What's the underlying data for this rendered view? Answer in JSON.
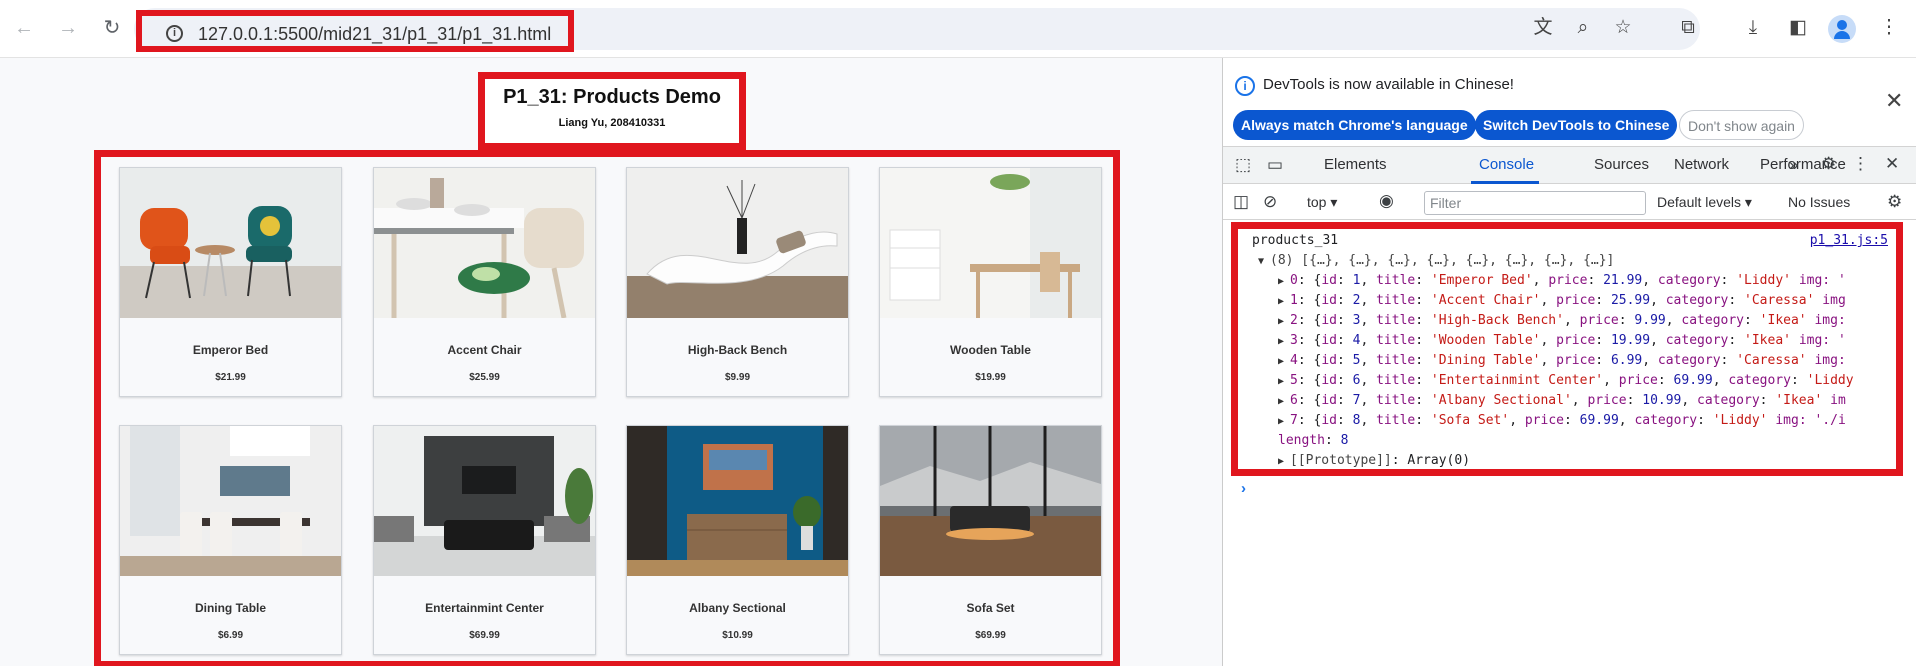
{
  "browser": {
    "url": "127.0.0.1:5500/mid21_31/p1_31/p1_31.html"
  },
  "page": {
    "title": "P1_31: Products Demo",
    "subtitle": "Liang Yu, 208410331",
    "products": [
      {
        "name": "Emperor Bed",
        "price": "$21.99"
      },
      {
        "name": "Accent Chair",
        "price": "$25.99"
      },
      {
        "name": "High-Back Bench",
        "price": "$9.99"
      },
      {
        "name": "Wooden Table",
        "price": "$19.99"
      },
      {
        "name": "Dining Table",
        "price": "$6.99"
      },
      {
        "name": "Entertainmint Center",
        "price": "$69.99"
      },
      {
        "name": "Albany Sectional",
        "price": "$10.99"
      },
      {
        "name": "Sofa Set",
        "price": "$69.99"
      }
    ]
  },
  "devtools": {
    "banner": "DevTools is now available in Chinese!",
    "btn_match": "Always match Chrome's language",
    "btn_switch": "Switch DevTools to Chinese",
    "btn_dont": "Don't show again",
    "tabs": [
      "Elements",
      "Console",
      "Sources",
      "Network",
      "Performance"
    ],
    "context": "top",
    "filter_placeholder": "Filter",
    "levels": "Default levels",
    "issues": "No Issues",
    "console": {
      "label": "products_31",
      "source": "p1_31.js:5",
      "summary": "(8) [{…}, {…}, {…}, {…}, {…}, {…}, {…}, {…}]",
      "rows": [
        {
          "index": "0",
          "id": "1",
          "title": "'Emperor Bed'",
          "price": "21.99",
          "category": "'Liddy'",
          "tail": "img: '"
        },
        {
          "index": "1",
          "id": "2",
          "title": "'Accent Chair'",
          "price": "25.99",
          "category": "'Caressa'",
          "tail": "img"
        },
        {
          "index": "2",
          "id": "3",
          "title": "'High-Back Bench'",
          "price": "9.99",
          "category": "'Ikea'",
          "tail": "img:"
        },
        {
          "index": "3",
          "id": "4",
          "title": "'Wooden Table'",
          "price": "19.99",
          "category": "'Ikea'",
          "tail": "img: '"
        },
        {
          "index": "4",
          "id": "5",
          "title": "'Dining Table'",
          "price": "6.99",
          "category": "'Caressa'",
          "tail": "img:"
        },
        {
          "index": "5",
          "id": "6",
          "title": "'Entertainmint Center'",
          "price": "69.99",
          "category": "'Liddy",
          "tail": ""
        },
        {
          "index": "6",
          "id": "7",
          "title": "'Albany Sectional'",
          "price": "10.99",
          "category": "'Ikea'",
          "tail": "im"
        },
        {
          "index": "7",
          "id": "8",
          "title": "'Sofa Set'",
          "price": "69.99",
          "category": "'Liddy'",
          "tail": "img: './i"
        }
      ],
      "length_label": "length",
      "length_value": "8",
      "proto_label": "[[Prototype]]",
      "proto_value": "Array(0)"
    }
  }
}
